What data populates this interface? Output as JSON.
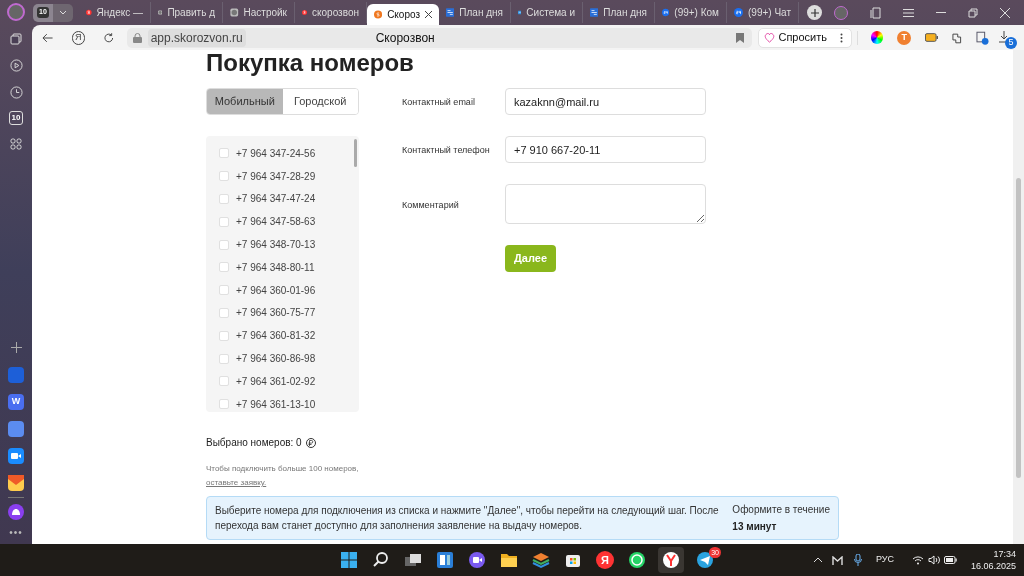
{
  "browser": {
    "tab_count": "10",
    "tabs": [
      {
        "label": "Яндекс —",
        "kind": "ya",
        "selected": false
      },
      {
        "label": "Править д",
        "kind": "circle",
        "selected": false
      },
      {
        "label": "Настройк",
        "kind": "circle",
        "selected": false
      },
      {
        "label": "скорозвон",
        "kind": "ya",
        "selected": false
      },
      {
        "label": "Скороз",
        "kind": "sk",
        "selected": true
      },
      {
        "label": "План дня",
        "kind": "plan",
        "selected": false
      },
      {
        "label": "Система и",
        "kind": "im",
        "selected": false
      },
      {
        "label": "План дня",
        "kind": "plan",
        "selected": false
      },
      {
        "label": "(99+) Ком",
        "kind": "b24",
        "selected": false
      },
      {
        "label": "(99+) Чат",
        "kind": "b24",
        "selected": false
      }
    ],
    "yandex_button": "Я",
    "url": "app.skorozvon.ru",
    "page_title": "Скорозвон",
    "ask_button": "Спросить",
    "extension_letter": "T",
    "sidebar_badge": "10",
    "downloads_badge": "5"
  },
  "sidebar": {
    "word_app": "W",
    "more": "•••"
  },
  "page": {
    "title": "Покупка номеров",
    "number_types": [
      {
        "label": "Мобильный",
        "selected": true
      },
      {
        "label": "Городской",
        "selected": false
      }
    ],
    "numbers": [
      {
        "number": "+7 964 347-24-56",
        "checked": false
      },
      {
        "number": "+7 964 347-28-29",
        "checked": false
      },
      {
        "number": "+7 964 347-47-24",
        "checked": false
      },
      {
        "number": "+7 964 347-58-63",
        "checked": false
      },
      {
        "number": "+7 964 348-70-13",
        "checked": false
      },
      {
        "number": "+7 964 348-80-11",
        "checked": false
      },
      {
        "number": "+7 964 360-01-96",
        "checked": false
      },
      {
        "number": "+7 964 360-75-77",
        "checked": false
      },
      {
        "number": "+7 964 360-81-32",
        "checked": false
      },
      {
        "number": "+7 964 360-86-98",
        "checked": false
      },
      {
        "number": "+7 964 361-02-92",
        "checked": false
      },
      {
        "number": "+7 964 361-13-10",
        "checked": false
      }
    ],
    "form": [
      {
        "label": "Контактный email",
        "value": "kazaknn@mail.ru",
        "kind": "input"
      },
      {
        "label": "Контактный телефон",
        "value": "+7 910 667-20-11",
        "kind": "input"
      },
      {
        "label": "Комментарий",
        "kind": "textarea"
      }
    ],
    "next_button": "Далее",
    "selected_count": "Выбрано номеров: 0",
    "note": "Чтобы подключить больше 100 номеров,",
    "note_link": "оставьте заявку.",
    "info": "Выберите номера для подключения из списка и нажмите \"Далее\", чтобы перейти на следующий шаг. После перехода вам станет доступно для заполнения заявление на выдачу номеров.",
    "deadline_label": "Оформите в течение",
    "deadline_value": "13 минут"
  },
  "taskbar": {
    "yandex_app": "Я",
    "telegram_badge": "30",
    "language": "РУС",
    "time": "17:34",
    "date": "16.06.2025"
  }
}
